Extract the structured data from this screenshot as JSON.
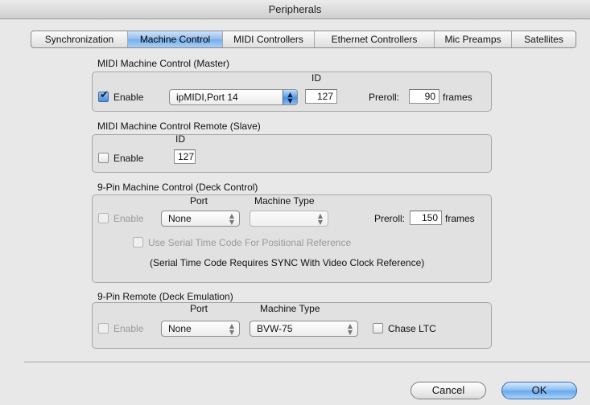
{
  "window": {
    "title": "Peripherals"
  },
  "tabs": [
    {
      "label": "Synchronization",
      "active": false
    },
    {
      "label": "Machine Control",
      "active": true
    },
    {
      "label": "MIDI Controllers",
      "active": false
    },
    {
      "label": "Ethernet Controllers",
      "active": false
    },
    {
      "label": "Mic Preamps",
      "active": false
    },
    {
      "label": "Satellites",
      "active": false
    }
  ],
  "mmc_master": {
    "title": "MIDI Machine Control (Master)",
    "enable_label": "Enable",
    "enabled": true,
    "port_value": "ipMIDI,Port 14",
    "id_label": "ID",
    "id_value": "127",
    "preroll_label": "Preroll:",
    "preroll_value": "90",
    "frames_label": "frames"
  },
  "mmc_remote": {
    "title": "MIDI Machine Control Remote (Slave)",
    "enable_label": "Enable",
    "enabled": false,
    "id_label": "ID",
    "id_value": "127"
  },
  "ninepin_control": {
    "title": "9-Pin Machine Control (Deck Control)",
    "port_label": "Port",
    "machine_type_label": "Machine Type",
    "enable_label": "Enable",
    "port_value": "None",
    "machine_type_value": "",
    "preroll_label": "Preroll:",
    "preroll_value": "150",
    "frames_label": "frames",
    "serial_tc_label": "Use Serial Time Code For Positional Reference",
    "serial_tc_note": "(Serial Time Code Requires SYNC With Video Clock Reference)"
  },
  "ninepin_remote": {
    "title": "9-Pin Remote (Deck Emulation)",
    "port_label": "Port",
    "machine_type_label": "Machine Type",
    "enable_label": "Enable",
    "port_value": "None",
    "machine_type_value": "BVW-75",
    "chase_ltc_label": "Chase LTC"
  },
  "buttons": {
    "cancel": "Cancel",
    "ok": "OK"
  },
  "icons": {
    "select_arrows": "up-down-arrows-icon",
    "checkmark": "checkmark-icon"
  }
}
